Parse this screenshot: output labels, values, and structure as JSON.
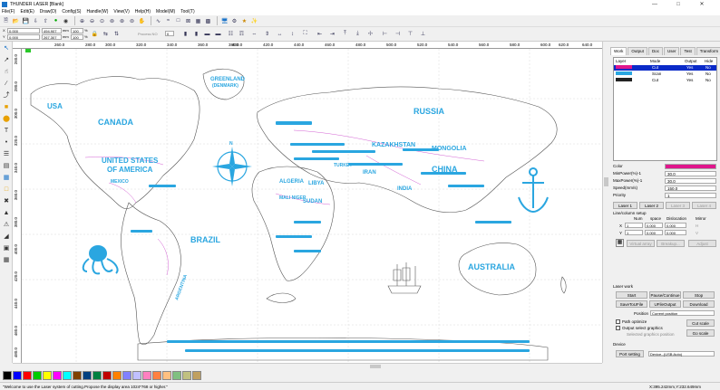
{
  "window": {
    "title": "THUNDER LASER [Blank]"
  },
  "menu": [
    "File(F)",
    "Edit(E)",
    "Draw(D)",
    "Config(S)",
    "Handle(W)",
    "View(V)",
    "Help(H)",
    "Model(M)",
    "Tool(T)"
  ],
  "toolbar2": {
    "x_label": "X",
    "y_label": "Y",
    "x_value": "0.000",
    "y_value": "0.000",
    "w_value": "494.907",
    "h_value": "267.307",
    "unit": "mm",
    "sx_value": "100",
    "sy_value": "100",
    "pct": "%",
    "process_label": "Process NO",
    "process_value": "0"
  },
  "ruler_h": [
    "260.0",
    "280.0",
    "300.0",
    "320.0",
    "340.0",
    "360.0",
    "380.0",
    "400.0",
    "420.0",
    "440.0",
    "460.0",
    "480.0",
    "500.0",
    "520.0",
    "540.0",
    "560.0",
    "580.0",
    "600.0",
    "620.0",
    "640.0"
  ],
  "ruler_v": [
    "260.0",
    "280.0",
    "300.0",
    "320.0",
    "340.0",
    "360.0",
    "380.0",
    "400.0",
    "420.0",
    "440.0",
    "460.0",
    "480.0"
  ],
  "map_labels": {
    "greenland": "GREENLAND",
    "greenland_sub": "(DENMARK)",
    "usa": "USA",
    "canada": "CANADA",
    "us_line1": "UNITED STATES",
    "us_line2": "OF AMERICA",
    "mexico": "MEXICO",
    "brazil": "BRAZIL",
    "argentina": "ARGENTINA",
    "russia": "RUSSIA",
    "kazakhstan": "KAZAKHSTAN",
    "mongolia": "MONGOLIA",
    "china": "CHINA",
    "india": "INDIA",
    "iran": "IRAN",
    "turkey": "TURKEY",
    "algeria": "ALGERIA",
    "libya": "LIBYA",
    "sudan": "SUDAN",
    "mali": "MALI NIGER",
    "australia": "AUSTRALIA",
    "compass_n": "N"
  },
  "panel": {
    "tabs": [
      "Work",
      "Output",
      "Doc",
      "User",
      "Test",
      "Transform"
    ],
    "layer_headers": {
      "layer": "Layer",
      "mode": "Mode",
      "output": "Output",
      "hide": "Hide"
    },
    "layers": [
      {
        "color": "#e0168c",
        "mode": "Cut",
        "output": "Yes",
        "hide": "No",
        "selected": true
      },
      {
        "color": "#2aa6e0",
        "mode": "Scan",
        "output": "Yes",
        "hide": "No",
        "selected": false
      },
      {
        "color": "#222222",
        "mode": "Cut",
        "output": "Yes",
        "hide": "No",
        "selected": false
      }
    ],
    "props": [
      {
        "label": "Color",
        "value": ""
      },
      {
        "label": "MinPower(%)-1",
        "value": "30.0"
      },
      {
        "label": "MaxPower(%)-1",
        "value": "30.0"
      },
      {
        "label": "Speed(mm/s)",
        "value": "150.0"
      },
      {
        "label": "Priority",
        "value": "1"
      }
    ],
    "laser_buttons": [
      "Laser 1",
      "Laser 2",
      "Laser 3",
      "Laser 4"
    ],
    "array_title": "Line/column setup",
    "array_headers": {
      "num": "Num",
      "space": "space",
      "dislocation": "Dislocation",
      "mirror": "Mirror"
    },
    "array_rows": [
      {
        "axis": "X",
        "num": "1",
        "space": "0.000",
        "disloc": "0.000",
        "mirror": "H"
      },
      {
        "axis": "Y",
        "num": "1",
        "space": "0.000",
        "disloc": "0.000",
        "mirror": "V"
      }
    ],
    "array_buttons": [
      "Virtual array",
      "Breakup...",
      "Adjust"
    ],
    "laser_work_title": "Laser work",
    "work_buttons": [
      "Start",
      "Pause/Continue",
      "Stop",
      "SaveToUFile",
      "UFileOutput",
      "Download"
    ],
    "position_label": "Position",
    "position_value": "Current position",
    "path_optimize": "Path optimize",
    "output_select": "Output select graphics",
    "selected_position": "Selected graphics position",
    "cut_scale": "Cut scale",
    "go_scale": "Go scale",
    "device_title": "Device",
    "port_setting": "Port setting",
    "device_value": "Device--(USB:Auto)"
  },
  "palette": [
    "#000000",
    "#0000ff",
    "#ff0000",
    "#00cc00",
    "#ffff00",
    "#ff00ff",
    "#00ffff",
    "#804000",
    "#004080",
    "#008040",
    "#c00000",
    "#ff8000",
    "#8080ff",
    "#c0c0ff",
    "#ff80c0",
    "#ff8040",
    "#ffc080",
    "#80c080",
    "#c0c080",
    "#c0a060"
  ],
  "status": {
    "message": "\"Welcome to use the Laser system of cutting.Propose the display area 1024*768 or higher.\"",
    "coords": "X:395.242mm,Y:232.649mm"
  }
}
